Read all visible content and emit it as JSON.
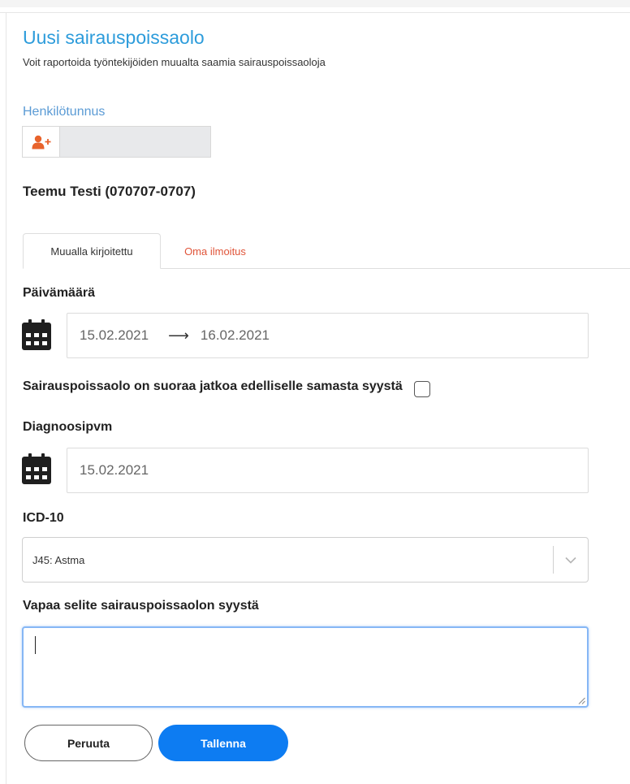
{
  "header": {
    "title": "Uusi sairauspoissaolo",
    "subtitle": "Voit raportoida työntekijöiden muualta saamia sairauspoissaoloja"
  },
  "hetu": {
    "label": "Henkilötunnus",
    "value": "",
    "button_icon": "add-person-icon"
  },
  "person": {
    "name": "Teemu Testi (070707-0707)"
  },
  "tabs": [
    {
      "label": "Muualla kirjoitettu",
      "active": true
    },
    {
      "label": "Oma ilmoitus",
      "active": false
    }
  ],
  "date_range": {
    "label": "Päivämäärä",
    "start": "15.02.2021",
    "arrow": "⟶",
    "end": "16.02.2021",
    "icon": "calendar-icon"
  },
  "continuation": {
    "label": "Sairauspoissaolo on suoraa jatkoa edelliselle samasta syystä",
    "checked": false
  },
  "diagnosis_date": {
    "label": "Diagnoosipvm",
    "value": "15.02.2021",
    "icon": "calendar-icon"
  },
  "icd": {
    "label": "ICD-10",
    "value": "J45: Astma"
  },
  "reason": {
    "label": "Vapaa selite sairauspoissaolon syystä",
    "value": ""
  },
  "actions": {
    "cancel_label": "Peruuta",
    "save_label": "Tallenna"
  },
  "colors": {
    "title": "#2d9cdb",
    "field_label": "#5b9bd5",
    "icon_orange": "#e8632c",
    "inactive_tab": "#e0553a",
    "primary_button": "#0d7cf2",
    "focus_border": "#86b7f5"
  }
}
